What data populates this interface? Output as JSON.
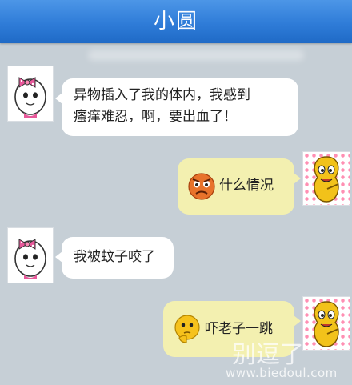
{
  "header": {
    "title": "小圆"
  },
  "messages": [
    {
      "side": "left",
      "text_line1": "异物插入了我的体内，我感到",
      "text_line2": "瘙痒难忍，啊，要出血了！",
      "avatar": "ribbon-girl-avatar"
    },
    {
      "side": "right",
      "text": "什么情况",
      "emoji": "angry-face-emoji",
      "avatar": "peanut-avatar"
    },
    {
      "side": "left",
      "text": "我被蚊子咬了",
      "avatar": "ribbon-girl-avatar"
    },
    {
      "side": "right",
      "text": "吓老子一跳",
      "emoji": "thinking-face-emoji",
      "avatar": "peanut-avatar"
    }
  ],
  "watermark": {
    "brand": "别逗了",
    "url": "www.biedoul.com"
  },
  "colors": {
    "header": "#2f7cd8",
    "background": "#c6cfd6",
    "bubble_right": "#f3f0b0",
    "bubble_left": "#ffffff"
  }
}
